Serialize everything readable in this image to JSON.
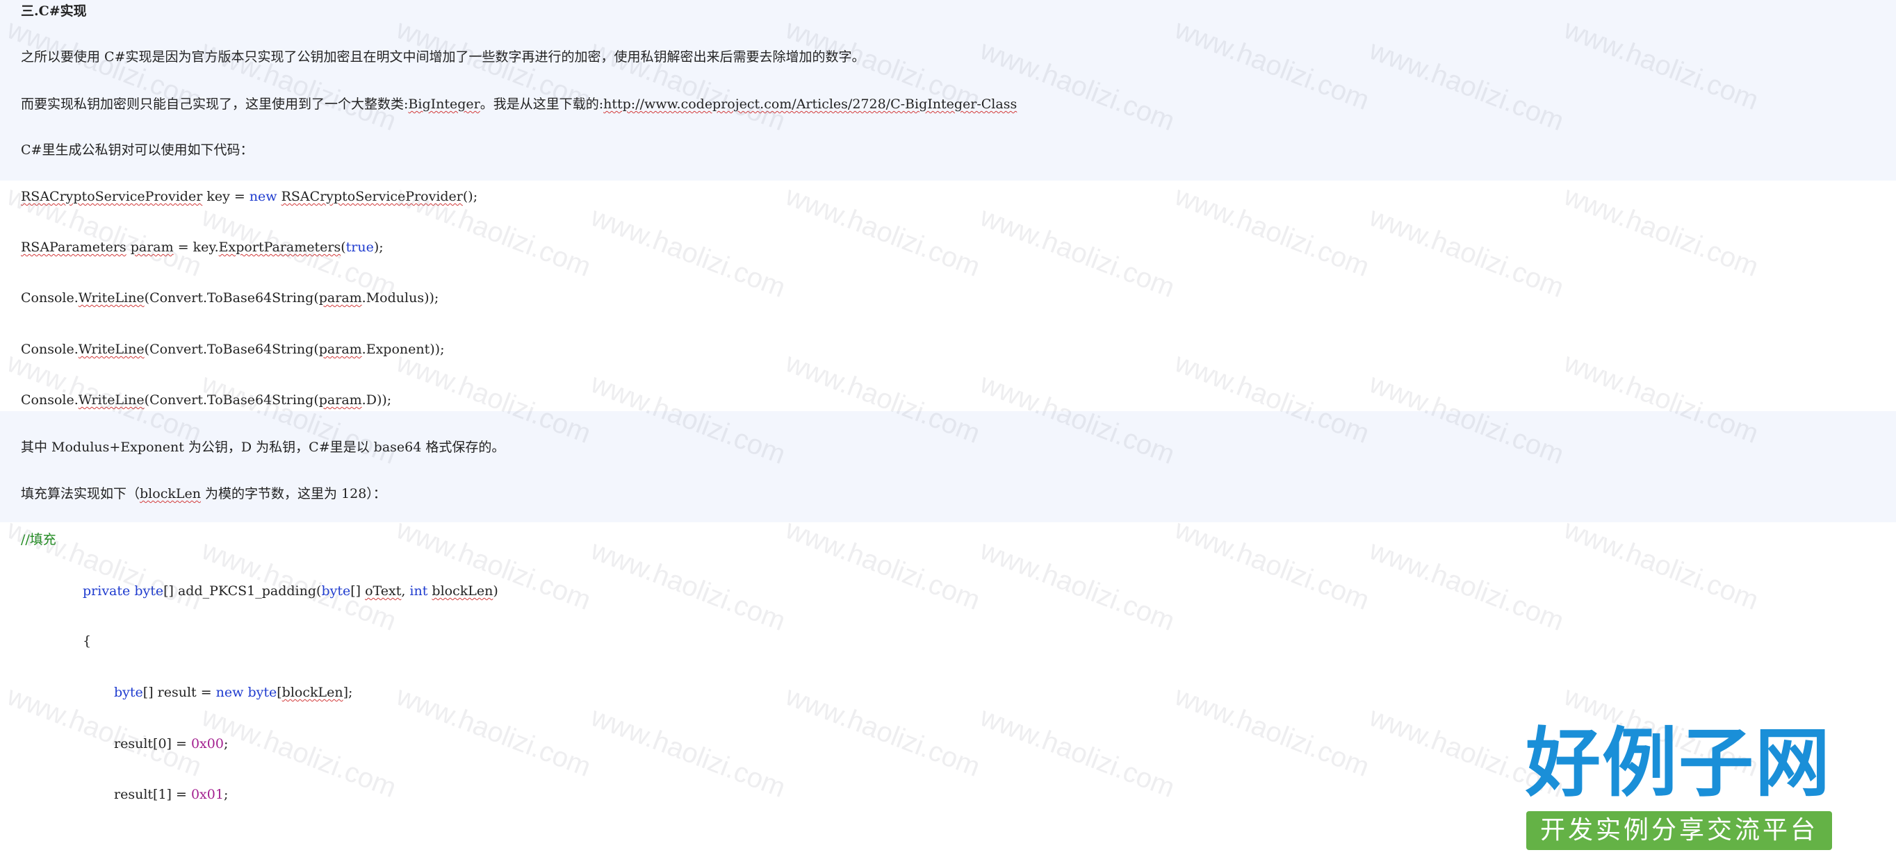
{
  "article": {
    "section_heading": "三.C#实现",
    "paragraphs": {
      "p1": "之所以要使用 C#实现是因为官方版本只实现了公钥加密且在明文中间增加了一些数字再进行的加密，使用私钥解密出来后需要去除增加的数字。",
      "p2_prefix": "而要实现私钥加密则只能自己实现了，这里使用到了一个大整数类:",
      "p2_class": "BigInteger",
      "p2_mid": "。我是从这里下载的:",
      "p2_link": "http://www.codeproject.com/Articles/2728/C-BigInteger-Class",
      "p3": "C#里生成公私钥对可以使用如下代码：",
      "p4": "其中 Modulus+Exponent 为公钥，D 为私钥，C#里是以 base64 格式保存的。",
      "p5_prefix": "填充算法实现如下（",
      "p5_var": "blockLen",
      "p5_suffix": " 为模的字节数，这里为 128）："
    },
    "code1": {
      "l1_t1": "RSACryptoServiceProvider",
      "l1_t2": " key = ",
      "l1_t3": "new",
      "l1_t4": " ",
      "l1_t5": "RSACryptoServiceProvider",
      "l1_t6": "();",
      "l2_t1": "RSAParameters",
      "l2_t2": " ",
      "l2_t3": "param",
      "l2_t4": " = key.",
      "l2_t5": "ExportParameters",
      "l2_t6": "(",
      "l2_t7": "true",
      "l2_t8": ");",
      "l3_t1": "Console.",
      "l3_t2": "WriteLine",
      "l3_t3": "(Convert.ToBase64String(",
      "l3_t4": "param",
      "l3_t5": ".Modulus));",
      "l4_t1": "Console.",
      "l4_t2": "WriteLine",
      "l4_t3": "(Convert.ToBase64String(",
      "l4_t4": "param",
      "l4_t5": ".Exponent));",
      "l5_t1": "Console.",
      "l5_t2": "WriteLine",
      "l5_t3": "(Convert.ToBase64String(",
      "l5_t4": "param",
      "l5_t5": ".D));"
    },
    "code2": {
      "comment": "//填充",
      "sig_t1": "private",
      "sig_t2": " ",
      "sig_t3": "byte",
      "sig_t4": "[] add_PKCS1_padding(",
      "sig_t5": "byte",
      "sig_t6": "[] ",
      "sig_t7": "oText",
      "sig_t8": ", ",
      "sig_t9": "int",
      "sig_t10": " ",
      "sig_t11": "blockLen",
      "sig_t12": ")",
      "brace": "{",
      "l1_t1": "byte",
      "l1_t2": "[] result = ",
      "l1_t3": "new",
      "l1_t4": " ",
      "l1_t5": "byte",
      "l1_t6": "[",
      "l1_t7": "blockLen",
      "l1_t8": "];",
      "l2_t1": "result[0] = ",
      "l2_t2": "0x00",
      "l2_t3": ";",
      "l3_t1": "result[1] = ",
      "l3_t2": "0x01",
      "l3_t3": ";"
    }
  },
  "watermark": {
    "text": "www.haolizi.com"
  },
  "logo": {
    "main": "好例子网",
    "sub": "开发实例分享交流平台"
  },
  "colors": {
    "keyword": "#1f3ccf",
    "comment": "#1e8a1e",
    "number": "#a31f8f",
    "highlight_band": "#f3f6fd",
    "logo_blue": "#1a8fd8",
    "logo_green": "#64b246"
  }
}
